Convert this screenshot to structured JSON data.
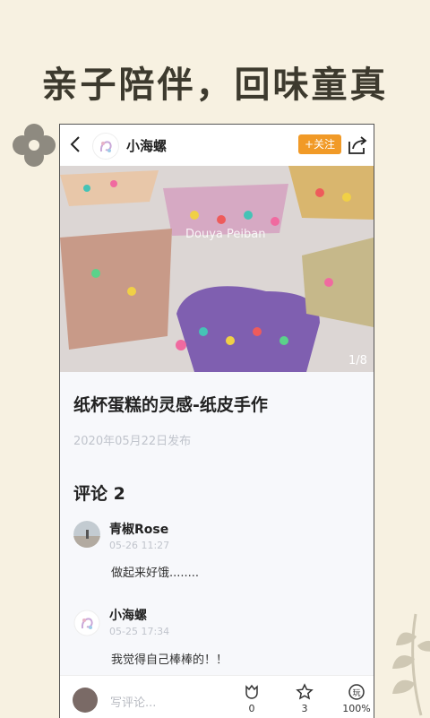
{
  "banner": "亲子陪伴，回味童真",
  "header": {
    "user_name": "小海螺",
    "follow_label": "+关注"
  },
  "image": {
    "counter": "1/8",
    "watermark": "Douya Peiban"
  },
  "post": {
    "title": "纸杯蛋糕的灵感-纸皮手作",
    "date": "2020年05月22日发布"
  },
  "comments": {
    "heading": "评论 2",
    "items": [
      {
        "name": "青椒Rose",
        "time": "05-26 11:27",
        "text": "做起来好饿........"
      },
      {
        "name": "小海螺",
        "time": "05-25 17:34",
        "text": "我觉得自己棒棒的！！"
      }
    ]
  },
  "bottom": {
    "placeholder": "写评论...",
    "like_count": "0",
    "star_count": "3",
    "play_count": "100%"
  },
  "colors": {
    "background": "#f7f1e1",
    "accent": "#f19a27"
  }
}
